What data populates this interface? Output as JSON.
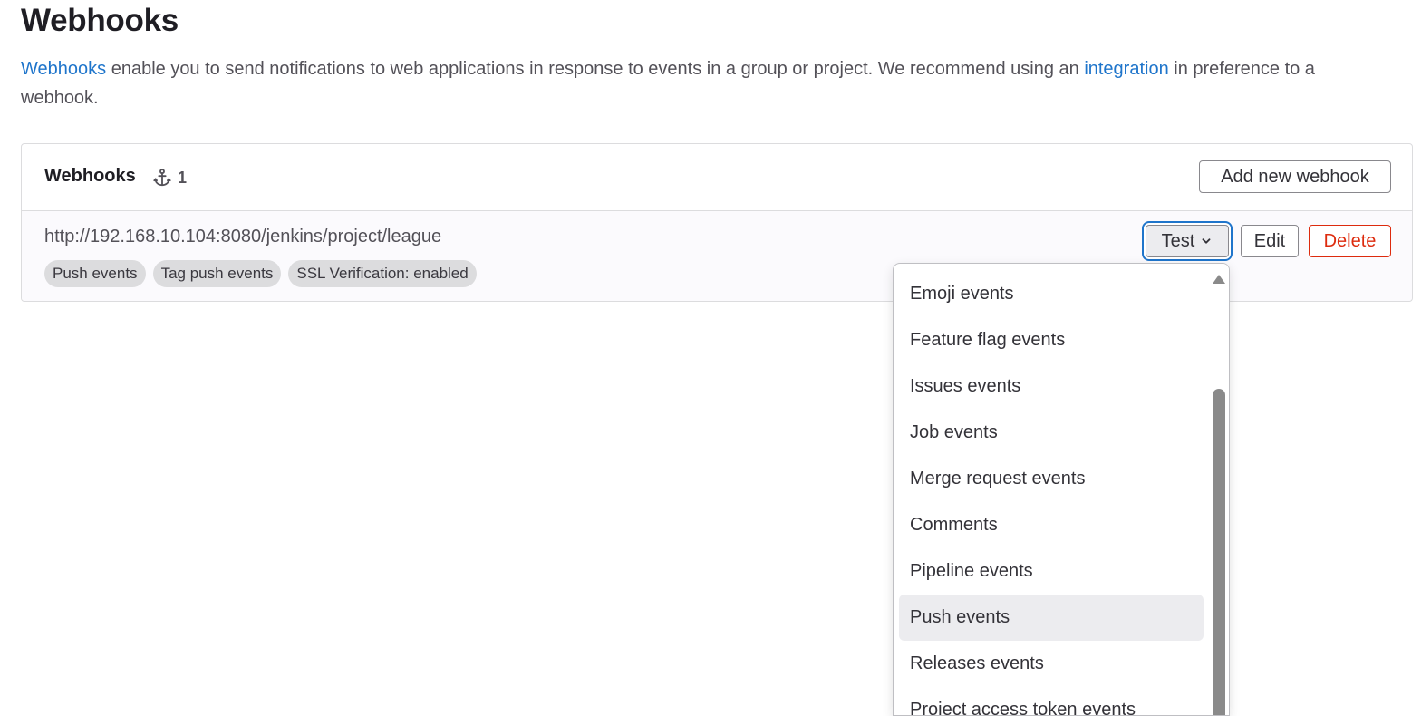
{
  "page": {
    "title": "Webhooks",
    "intro_link_webhooks": "Webhooks",
    "intro_text_1": " enable you to send notifications to web applications in response to events in a group or project. We recommend using an ",
    "intro_link_integration": "integration",
    "intro_text_2": " in preference to a webhook."
  },
  "card": {
    "title": "Webhooks",
    "count_icon": "webhook-anchor-icon",
    "count": "1",
    "add_button": "Add new webhook"
  },
  "webhook": {
    "url": "http://192.168.10.104:8080/jenkins/project/league",
    "badges": [
      "Push events",
      "Tag push events",
      "SSL Verification: enabled"
    ],
    "test_button": "Test",
    "test_icon": "chevron-down-icon",
    "edit_button": "Edit",
    "delete_button": "Delete"
  },
  "dropdown": {
    "items": [
      "Emoji events",
      "Feature flag events",
      "Issues events",
      "Job events",
      "Merge request events",
      "Comments",
      "Pipeline events",
      "Push events",
      "Releases events",
      "Project access token events"
    ],
    "highlighted": "Push events"
  },
  "colors": {
    "link": "#1f75cb",
    "danger": "#dd2b0e",
    "focus_ring": "#1f75cb",
    "badge_bg": "#dcdcde"
  }
}
